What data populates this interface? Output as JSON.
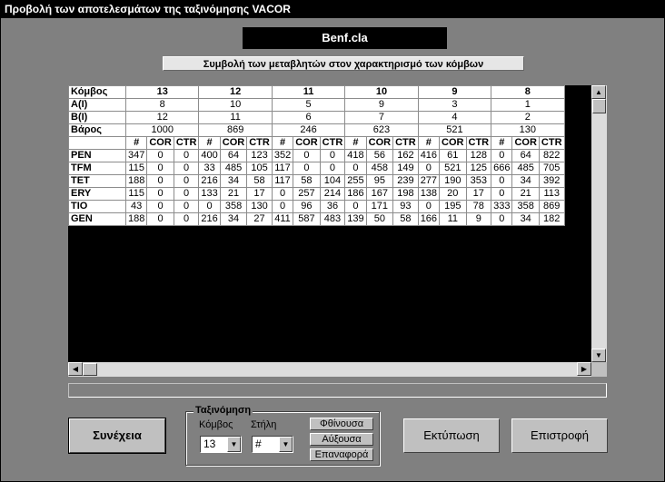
{
  "window": {
    "title": "Προβολή των αποτελεσμάτων της ταξινόμησης VACOR"
  },
  "file_name": "Benf.cla",
  "subtitle": "Συμβολή των μεταβλητών στον χαρακτηρισμό των κόμβων",
  "grid": {
    "node_label": "Κόμβος",
    "a_label": "A(I)",
    "b_label": "B(I)",
    "weight_label": "Βάρος",
    "sub_headers": [
      "#",
      "COR",
      "CTR"
    ],
    "nodes": [
      {
        "node": "13",
        "a": "8",
        "b": "12",
        "weight": "1000"
      },
      {
        "node": "12",
        "a": "10",
        "b": "11",
        "weight": "869"
      },
      {
        "node": "11",
        "a": "5",
        "b": "6",
        "weight": "246"
      },
      {
        "node": "10",
        "a": "9",
        "b": "7",
        "weight": "623"
      },
      {
        "node": "9",
        "a": "3",
        "b": "4",
        "weight": "521"
      },
      {
        "node": "8",
        "a": "1",
        "b": "2",
        "weight": "130"
      }
    ],
    "rows": [
      {
        "name": "PEN",
        "values": [
          "347",
          "0",
          "0",
          "400",
          "64",
          "123",
          "352",
          "0",
          "0",
          "418",
          "56",
          "162",
          "416",
          "61",
          "128",
          "0",
          "64",
          "822"
        ]
      },
      {
        "name": "TFM",
        "values": [
          "115",
          "0",
          "0",
          "33",
          "485",
          "105",
          "117",
          "0",
          "0",
          "0",
          "458",
          "149",
          "0",
          "521",
          "125",
          "666",
          "485",
          "705"
        ]
      },
      {
        "name": "TET",
        "values": [
          "188",
          "0",
          "0",
          "216",
          "34",
          "58",
          "117",
          "58",
          "104",
          "255",
          "95",
          "239",
          "277",
          "190",
          "353",
          "0",
          "34",
          "392"
        ]
      },
      {
        "name": "ERY",
        "values": [
          "115",
          "0",
          "0",
          "133",
          "21",
          "17",
          "0",
          "257",
          "214",
          "186",
          "167",
          "198",
          "138",
          "20",
          "17",
          "0",
          "21",
          "113"
        ]
      },
      {
        "name": "TIO",
        "values": [
          "43",
          "0",
          "0",
          "0",
          "358",
          "130",
          "0",
          "96",
          "36",
          "0",
          "171",
          "93",
          "0",
          "195",
          "78",
          "333",
          "358",
          "869"
        ]
      },
      {
        "name": "GEN",
        "values": [
          "188",
          "0",
          "0",
          "216",
          "34",
          "27",
          "411",
          "587",
          "483",
          "139",
          "50",
          "58",
          "166",
          "11",
          "9",
          "0",
          "34",
          "182"
        ]
      }
    ]
  },
  "buttons": {
    "continue": "Συνέχεια",
    "print": "Εκτύπωση",
    "back": "Επιστροφή"
  },
  "sort": {
    "title": "Ταξινόμηση",
    "node_label": "Κόμβος",
    "column_label": "Στήλη",
    "node_value": "13",
    "column_value": "#",
    "descending": "Φθίνουσα",
    "ascending": "Αύξουσα",
    "reset": "Επαναφορά"
  }
}
